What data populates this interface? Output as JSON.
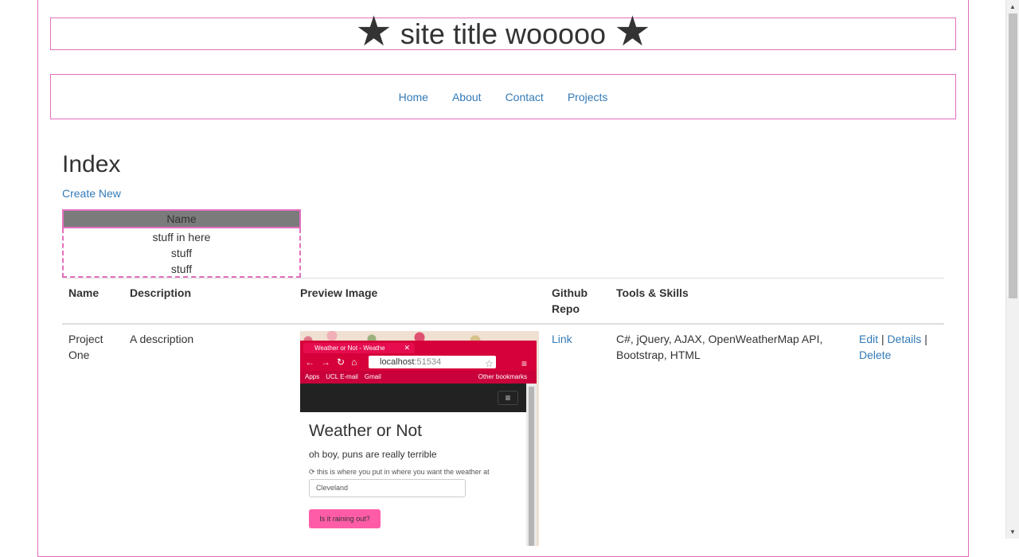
{
  "site": {
    "title": "site title wooooo",
    "star_glyph": "★"
  },
  "nav": {
    "items": [
      "Home",
      "About",
      "Contact",
      "Projects"
    ]
  },
  "page": {
    "heading": "Index",
    "create_link": "Create New"
  },
  "mini_table": {
    "header": "Name",
    "rows": [
      "stuff in here",
      "stuff",
      "stuff"
    ]
  },
  "table": {
    "headers": {
      "name": "Name",
      "description": "Description",
      "preview": "Preview Image",
      "github_line1": "Github",
      "github_line2": "Repo",
      "tools": "Tools & Skills"
    },
    "rows": [
      {
        "name_line1": "Project",
        "name_line2": "One",
        "description": "A description",
        "github": "Link",
        "tools": "C#, jQuery, AJAX, OpenWeatherMap API, Bootstrap, HTML",
        "edit": "Edit",
        "details": "Details",
        "delete": "Delete",
        "separator": "|"
      }
    ]
  },
  "preview": {
    "tab_title": "Weather or Not - Weathe",
    "url_host": "localhost",
    "url_port": ":51534",
    "bookmarks": [
      "Apps",
      "UCL E-mail",
      "Gmail"
    ],
    "other_bookmarks": "Other bookmarks",
    "app_title": "Weather or Not",
    "app_subtitle": "oh boy, puns are really terrible",
    "app_note": "this is where you put in where you want the weather at",
    "input_value": "Cleveland",
    "button_label": "Is it raining out?"
  },
  "colors": {
    "frame_pink": "#e36fbd",
    "link_blue": "#337ab7",
    "chrome_red": "#d6003a",
    "button_pink": "#ff5ca8"
  }
}
